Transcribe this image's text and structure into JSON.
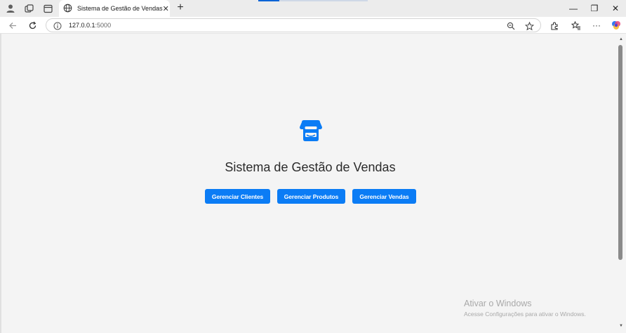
{
  "browser": {
    "tab_title": "Sistema de Gestão de Vendas",
    "tab_close": "✕",
    "new_tab": "+",
    "url_host": "127.0.0.1",
    "url_port": ":5000",
    "window_controls": {
      "minimize": "—",
      "restore": "❐",
      "close": "✕"
    },
    "more_label": "···"
  },
  "page": {
    "title": "Sistema de Gestão de Vendas",
    "buttons": {
      "clientes": "Gerenciar Clientes",
      "produtos": "Gerenciar Produtos",
      "vendas": "Gerenciar Vendas"
    },
    "accent_color": "#0b7cf5"
  },
  "watermark": {
    "title": "Ativar o Windows",
    "subtitle": "Acesse Configurações para ativar o Windows."
  },
  "icons": {
    "profile": "profile-icon",
    "workspaces": "workspaces-icon",
    "tab_actions": "tab-actions-icon",
    "store": "store-icon"
  }
}
